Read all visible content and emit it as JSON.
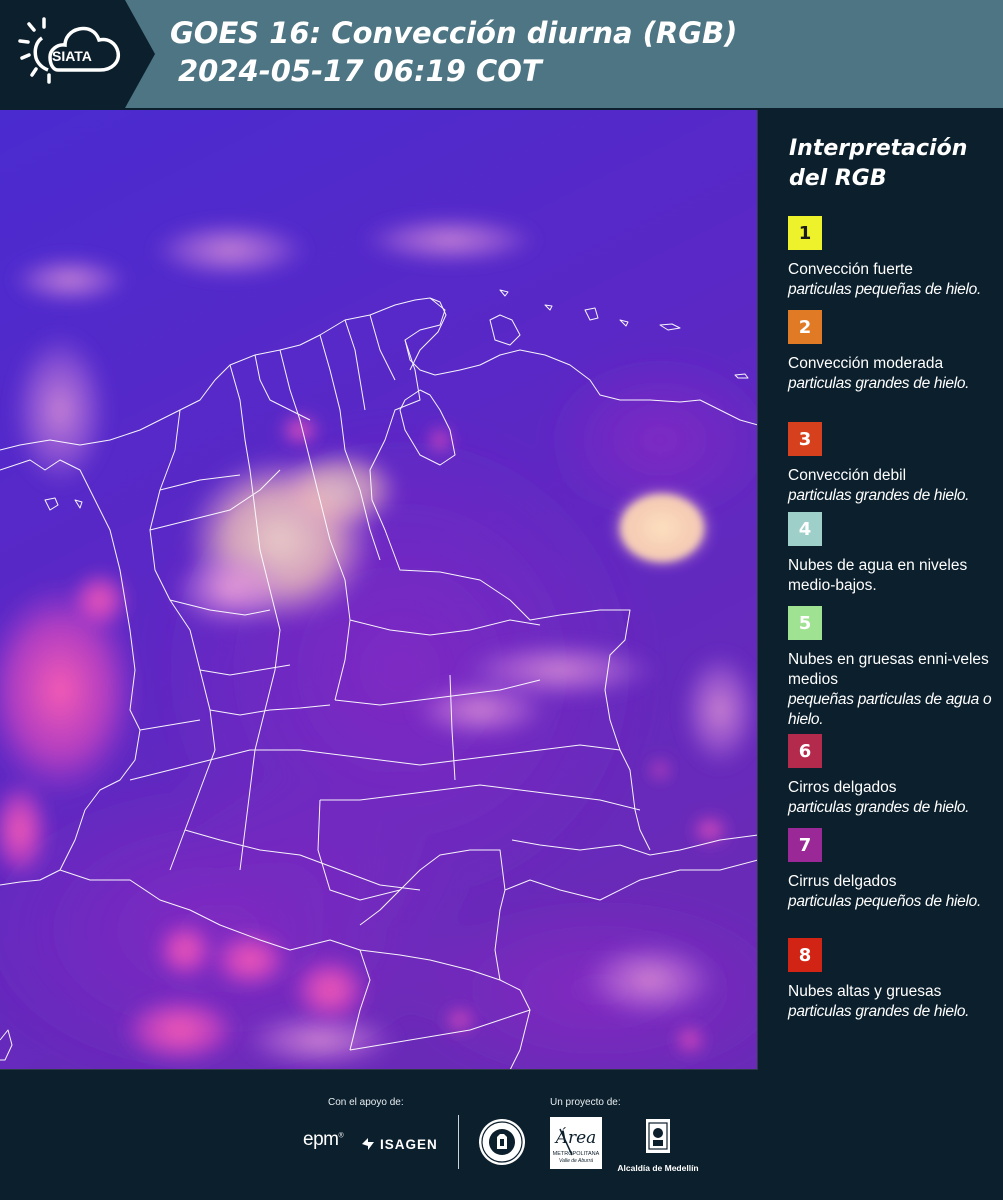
{
  "header": {
    "logo_text": "SIATA",
    "title_line1": "GOES 16: Convección diurna (RGB)",
    "title_line2": "2024-05-17 06:19 COT",
    "background": "#4d7583"
  },
  "map": {
    "description_colors": {
      "base": "#5a25c8",
      "convection": "#f3c6b0",
      "cirrus": "#ee4fb8"
    }
  },
  "legend": {
    "title": "Interpretación del RGB",
    "items": [
      {
        "number": "1",
        "color": "#eef22a",
        "title": "Convección fuerte",
        "subtitle": "particulas pequeñas de hielo."
      },
      {
        "number": "2",
        "color": "#e07a25",
        "title": "Convección moderada",
        "subtitle": "particulas grandes de hielo."
      },
      {
        "number": "3",
        "color": "#d6401c",
        "title": "Convección debil",
        "subtitle": "particulas grandes de hielo."
      },
      {
        "number": "4",
        "color": "#9fcfc9",
        "title": "Nubes de agua en niveles medio-bajos.",
        "subtitle": ""
      },
      {
        "number": "5",
        "color": "#9fe291",
        "title": "Nubes en gruesas enni-veles medios",
        "subtitle": "pequeñas particulas de agua o hielo."
      },
      {
        "number": "6",
        "color": "#b42a4c",
        "title": "Cirros delgados",
        "subtitle": "particulas grandes de hielo."
      },
      {
        "number": "7",
        "color": "#9a2896",
        "title": "Cirrus delgados",
        "subtitle": "particulas pequeños de hielo."
      },
      {
        "number": "8",
        "color": "#d12414",
        "title": "Nubes altas y gruesas",
        "subtitle": "particulas grandes de hielo."
      }
    ]
  },
  "footer": {
    "support_label": "Con el apoyo de:",
    "project_label": "Un proyecto de:",
    "sponsors": [
      "epm",
      "ISAGEN"
    ],
    "partners": {
      "area_name": "Área",
      "area_sub1": "METROPOLITANA",
      "area_sub2": "Valle de Aburrá",
      "alcaldia": "Alcaldía de Medellín"
    }
  }
}
